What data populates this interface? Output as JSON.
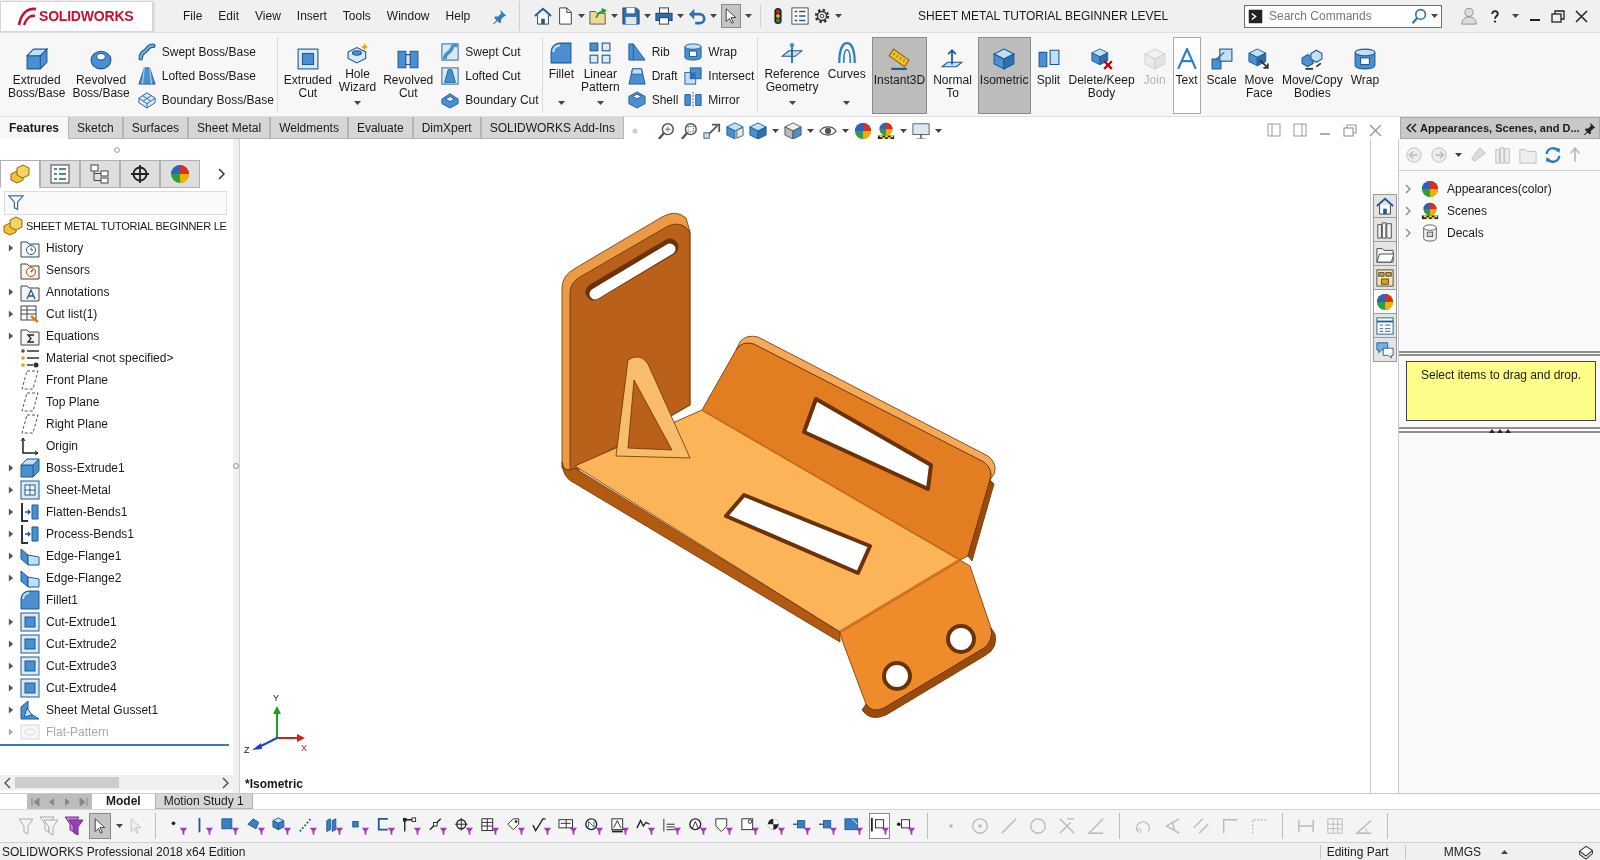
{
  "app": {
    "logo": "SOLIDWORKS",
    "menu": [
      "File",
      "Edit",
      "View",
      "Insert",
      "Tools",
      "Window",
      "Help"
    ]
  },
  "quick_access": {
    "select": {
      "selected": true
    }
  },
  "window": {
    "title": "SHEET METAL TUTORIAL BEGINNER LEVEL"
  },
  "search": {
    "placeholder": "Search Commands"
  },
  "ribbon": {
    "groups": [
      {
        "columns": [
          {
            "kind": "large",
            "label": "Extruded\nBoss/Base",
            "dropdown": false,
            "selected": false,
            "hovered": false,
            "disabled": false
          },
          {
            "kind": "large",
            "label": "Revolved\nBoss/Base",
            "dropdown": false,
            "selected": false,
            "hovered": false,
            "disabled": false
          },
          {
            "kind": "stack",
            "items": [
              "Swept Boss/Base",
              "Lofted Boss/Base",
              "Boundary Boss/Base"
            ]
          }
        ]
      },
      {
        "columns": [
          {
            "kind": "large",
            "label": "Extruded\nCut",
            "dropdown": false,
            "selected": false,
            "hovered": false,
            "disabled": false
          },
          {
            "kind": "large",
            "label": "Hole\nWizard",
            "dropdown": true,
            "selected": false,
            "hovered": false,
            "disabled": false
          },
          {
            "kind": "large",
            "label": "Revolved\nCut",
            "dropdown": false,
            "selected": false,
            "hovered": false,
            "disabled": false
          },
          {
            "kind": "stack",
            "items": [
              "Swept Cut",
              "Lofted Cut",
              "Boundary Cut"
            ]
          }
        ]
      },
      {
        "columns": [
          {
            "kind": "large",
            "label": "Fillet",
            "dropdown": true,
            "selected": false,
            "hovered": false,
            "disabled": false
          },
          {
            "kind": "large",
            "label": "Linear\nPattern",
            "dropdown": true,
            "selected": false,
            "hovered": false,
            "disabled": false
          },
          {
            "kind": "stack",
            "items": [
              "Rib",
              "Draft",
              "Shell"
            ]
          },
          {
            "kind": "stack",
            "items": [
              "Wrap",
              "Intersect",
              "Mirror"
            ]
          }
        ]
      },
      {
        "columns": [
          {
            "kind": "large",
            "label": "Reference\nGeometry",
            "dropdown": true,
            "selected": false,
            "hovered": false,
            "disabled": false
          },
          {
            "kind": "large",
            "label": "Curves",
            "dropdown": true,
            "selected": false,
            "hovered": false,
            "disabled": false
          },
          {
            "kind": "large",
            "label": "Instant3D",
            "dropdown": false,
            "selected": true,
            "hovered": false,
            "disabled": false
          },
          {
            "kind": "large",
            "label": "Normal\nTo",
            "dropdown": false,
            "selected": false,
            "hovered": false,
            "disabled": false
          },
          {
            "kind": "large",
            "label": "Isometric",
            "dropdown": false,
            "selected": true,
            "hovered": false,
            "disabled": false
          },
          {
            "kind": "large",
            "label": "Split",
            "dropdown": false,
            "selected": false,
            "hovered": false,
            "disabled": false
          },
          {
            "kind": "large",
            "label": "Delete/Keep\nBody",
            "dropdown": false,
            "selected": false,
            "hovered": false,
            "disabled": false
          },
          {
            "kind": "large",
            "label": "Join",
            "dropdown": false,
            "selected": false,
            "hovered": false,
            "disabled": true
          },
          {
            "kind": "large",
            "label": "Text",
            "dropdown": false,
            "selected": false,
            "hovered": true,
            "disabled": false
          },
          {
            "kind": "large",
            "label": "Scale",
            "dropdown": false,
            "selected": false,
            "hovered": false,
            "disabled": false
          },
          {
            "kind": "large",
            "label": "Move\nFace",
            "dropdown": false,
            "selected": false,
            "hovered": false,
            "disabled": false
          },
          {
            "kind": "large",
            "label": "Move/Copy\nBodies",
            "dropdown": false,
            "selected": false,
            "hovered": false,
            "disabled": false
          },
          {
            "kind": "large",
            "label": "Wrap",
            "dropdown": false,
            "selected": false,
            "hovered": false,
            "disabled": false
          }
        ]
      }
    ]
  },
  "command_tabs": [
    {
      "label": "Features",
      "selected": true
    },
    {
      "label": "Sketch",
      "selected": false
    },
    {
      "label": "Surfaces",
      "selected": false
    },
    {
      "label": "Sheet Metal",
      "selected": false
    },
    {
      "label": "Weldments",
      "selected": false
    },
    {
      "label": "Evaluate",
      "selected": false
    },
    {
      "label": "DimXpert",
      "selected": false
    },
    {
      "label": "SOLIDWORKS Add-Ins",
      "selected": false
    }
  ],
  "feature_manager": {
    "tabs": [
      {
        "selected": true
      },
      {
        "selected": false
      },
      {
        "selected": false
      },
      {
        "selected": false
      },
      {
        "selected": false
      }
    ],
    "root": "SHEET METAL TUTORIAL BEGINNER LE",
    "items": [
      {
        "label": "History",
        "expandable": true,
        "disabled": false
      },
      {
        "label": "Sensors",
        "expandable": false,
        "disabled": false
      },
      {
        "label": "Annotations",
        "expandable": true,
        "disabled": false
      },
      {
        "label": "Cut list(1)",
        "expandable": true,
        "disabled": false
      },
      {
        "label": "Equations",
        "expandable": true,
        "disabled": false
      },
      {
        "label": "Material <not specified>",
        "expandable": false,
        "disabled": false
      },
      {
        "label": "Front Plane",
        "expandable": false,
        "disabled": false
      },
      {
        "label": "Top Plane",
        "expandable": false,
        "disabled": false
      },
      {
        "label": "Right Plane",
        "expandable": false,
        "disabled": false
      },
      {
        "label": "Origin",
        "expandable": false,
        "disabled": false
      },
      {
        "label": "Boss-Extrude1",
        "expandable": true,
        "disabled": false
      },
      {
        "label": "Sheet-Metal",
        "expandable": true,
        "disabled": false
      },
      {
        "label": "Flatten-Bends1",
        "expandable": true,
        "disabled": false
      },
      {
        "label": "Process-Bends1",
        "expandable": true,
        "disabled": false
      },
      {
        "label": "Edge-Flange1",
        "expandable": true,
        "disabled": false
      },
      {
        "label": "Edge-Flange2",
        "expandable": true,
        "disabled": false
      },
      {
        "label": "Fillet1",
        "expandable": false,
        "disabled": false
      },
      {
        "label": "Cut-Extrude1",
        "expandable": true,
        "disabled": false
      },
      {
        "label": "Cut-Extrude2",
        "expandable": true,
        "disabled": false
      },
      {
        "label": "Cut-Extrude3",
        "expandable": true,
        "disabled": false
      },
      {
        "label": "Cut-Extrude4",
        "expandable": true,
        "disabled": false
      },
      {
        "label": "Sheet Metal Gusset1",
        "expandable": true,
        "disabled": false
      },
      {
        "label": "Flat-Pattern",
        "expandable": true,
        "disabled": true
      }
    ]
  },
  "viewport": {
    "view_name": "*Isometric",
    "triad": [
      "Y",
      "Z",
      "X"
    ]
  },
  "task_pane": {
    "tabs": [
      {
        "selected": false
      },
      {
        "selected": false
      },
      {
        "selected": false
      },
      {
        "selected": false
      },
      {
        "selected": true
      },
      {
        "selected": false
      },
      {
        "selected": false
      }
    ],
    "title": "Appearances, Scenes, and D...",
    "items": [
      {
        "label": "Appearances(color)",
        "expandable": true
      },
      {
        "label": "Scenes",
        "expandable": true
      },
      {
        "label": "Decals",
        "expandable": true
      }
    ],
    "hint": "Select items to drag and drop."
  },
  "bottom_tabs": [
    {
      "label": "Model",
      "selected": true
    },
    {
      "label": "Motion Study 1",
      "selected": false
    }
  ],
  "selection_toolbar": {
    "select": {
      "selected": true
    },
    "filters": [
      {
        "selected": false
      },
      {
        "selected": false
      },
      {
        "selected": false
      },
      {
        "selected": false
      },
      {
        "selected": false
      },
      {
        "selected": false
      },
      {
        "selected": false
      },
      {
        "selected": false
      },
      {
        "selected": false
      },
      {
        "selected": false
      },
      {
        "selected": false
      },
      {
        "selected": false
      },
      {
        "selected": false
      },
      {
        "selected": false
      },
      {
        "selected": false
      },
      {
        "selected": false
      },
      {
        "selected": false
      },
      {
        "selected": false
      },
      {
        "selected": false
      },
      {
        "selected": false
      },
      {
        "selected": false
      },
      {
        "selected": false
      },
      {
        "selected": false
      },
      {
        "selected": false
      },
      {
        "selected": false
      },
      {
        "selected": false
      },
      {
        "selected": false
      },
      {
        "selected": true
      },
      {
        "selected": false
      }
    ]
  },
  "status_bar": {
    "edition": "SOLIDWORKS Professional 2018 x64 Edition",
    "mode": "Editing Part",
    "units": "MMGS"
  }
}
